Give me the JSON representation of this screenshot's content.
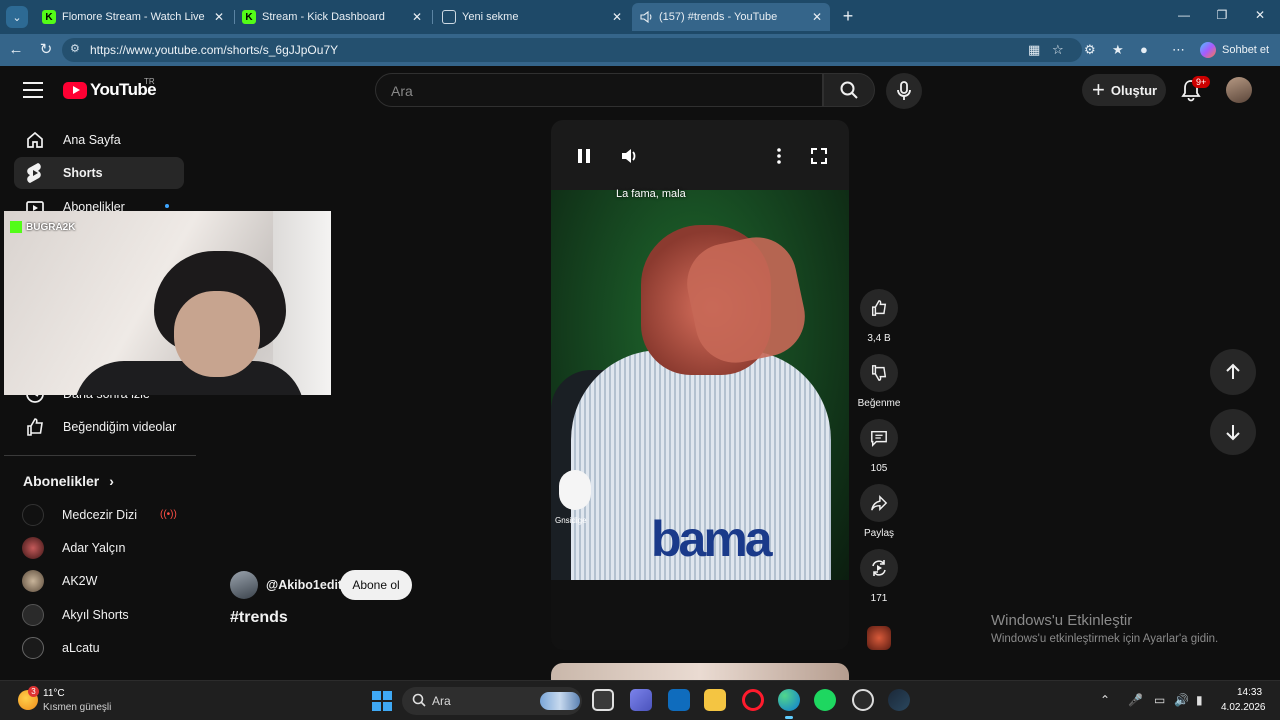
{
  "browser": {
    "tabs": [
      {
        "title": "Flomore Stream - Watch Live on K",
        "icon": "kick-icon"
      },
      {
        "title": "Stream - Kick Dashboard",
        "icon": "kick-icon"
      },
      {
        "title": "Yeni sekme",
        "icon": "new-tab-icon"
      },
      {
        "title": "(157) #trends - YouTube",
        "icon": "youtube-icon",
        "active": true
      }
    ],
    "url": "https://www.youtube.com/shorts/s_6gJJpOu7Y",
    "copilot_label": "Sohbet et"
  },
  "youtube": {
    "logo_text": "YouTube",
    "region": "TR",
    "search_placeholder": "Ara",
    "create_label": "Oluştur",
    "notification_count": "9+",
    "sidebar": {
      "items": [
        {
          "label": "Ana Sayfa",
          "icon": "home-icon"
        },
        {
          "label": "Shorts",
          "icon": "shorts-icon",
          "active": true
        },
        {
          "label": "Abonelikler",
          "icon": "subscriptions-icon"
        },
        {
          "label": "Daha sonra izle",
          "icon": "watch-later-icon"
        },
        {
          "label": "Beğendiğim videolar",
          "icon": "liked-videos-icon"
        }
      ],
      "subscriptions_title": "Abonelikler",
      "subscriptions": [
        {
          "name": "Medcezir Dizi",
          "live": true
        },
        {
          "name": "Adar Yalçın"
        },
        {
          "name": "AK2W"
        },
        {
          "name": "Akyıl Shorts"
        },
        {
          "name": "aLcatu"
        }
      ]
    },
    "webcam": {
      "streamer": "BUGRA2K"
    },
    "short": {
      "caption": "La fama, mala",
      "channel": "@Akibo1edit",
      "subscribe_label": "Abone ol",
      "title": "#trends",
      "jersey_text": "bama",
      "sponsor_text": "Gnsidige"
    },
    "actions": {
      "likes": "3,4 B",
      "dislike_label": "Beğenme",
      "comments": "105",
      "share_label": "Paylaş",
      "remix_count": "171"
    },
    "watermark": {
      "title": "Windows'u Etkinleştir",
      "subtitle": "Windows'u etkinleştirmek için Ayarlar'a gidin."
    }
  },
  "taskbar": {
    "weather_temp": "11°C",
    "weather_desc": "Kısmen güneşli",
    "weather_badge": "3",
    "search_placeholder": "Ara",
    "time": "14:33",
    "date": "4.02.2026"
  }
}
